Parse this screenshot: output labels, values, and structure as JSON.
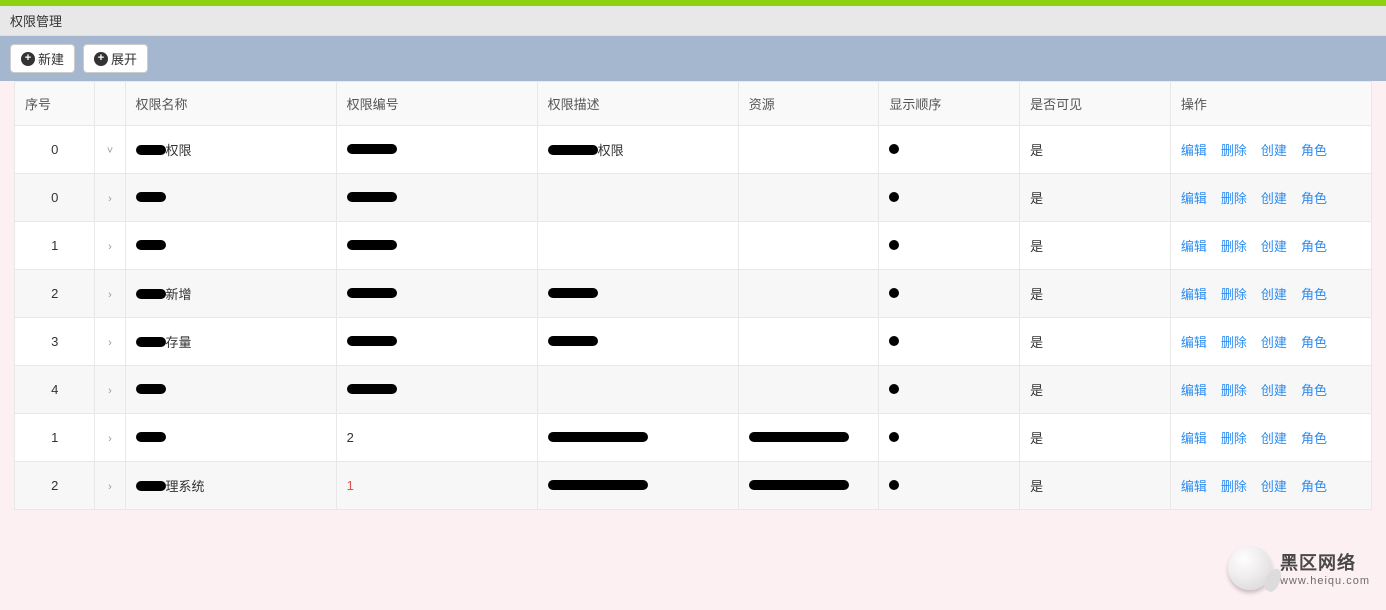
{
  "header": {
    "title": "权限管理"
  },
  "toolbar": {
    "new_label": "新建",
    "expand_label": "展开"
  },
  "table": {
    "columns": {
      "seq": "序号",
      "name": "权限名称",
      "code": "权限编号",
      "desc": "权限描述",
      "resource": "资源",
      "order": "显示顺序",
      "visible": "是否可见",
      "ops": "操作"
    },
    "ops_labels": {
      "edit": "编辑",
      "delete": "删除",
      "create": "创建",
      "role": "角色"
    },
    "rows": [
      {
        "seq": "0",
        "toggle": "v",
        "name_suffix": "权限",
        "desc_suffix": "权限",
        "visible": "是"
      },
      {
        "seq": "0",
        "toggle": ">",
        "name_suffix": "",
        "desc_suffix": "",
        "visible": "是"
      },
      {
        "seq": "1",
        "toggle": ">",
        "name_suffix": "",
        "desc_suffix": "",
        "visible": "是"
      },
      {
        "seq": "2",
        "toggle": ">",
        "name_suffix": "新增",
        "desc_suffix": "",
        "visible": "是"
      },
      {
        "seq": "3",
        "toggle": ">",
        "name_suffix": "存量",
        "desc_suffix": "",
        "visible": "是"
      },
      {
        "seq": "4",
        "toggle": ">",
        "name_suffix": "",
        "desc_suffix": "",
        "visible": "是"
      },
      {
        "seq": "1",
        "toggle": ">",
        "name_suffix": "",
        "code_text": "2",
        "desc_suffix": "",
        "visible": "是"
      },
      {
        "seq": "2",
        "toggle": ">",
        "name_suffix": "理系统",
        "code_text": "1",
        "code_red": true,
        "desc_suffix": "",
        "visible": "是"
      }
    ]
  },
  "watermark": {
    "cn": "黑区网络",
    "en": "www.heiqu.com"
  }
}
